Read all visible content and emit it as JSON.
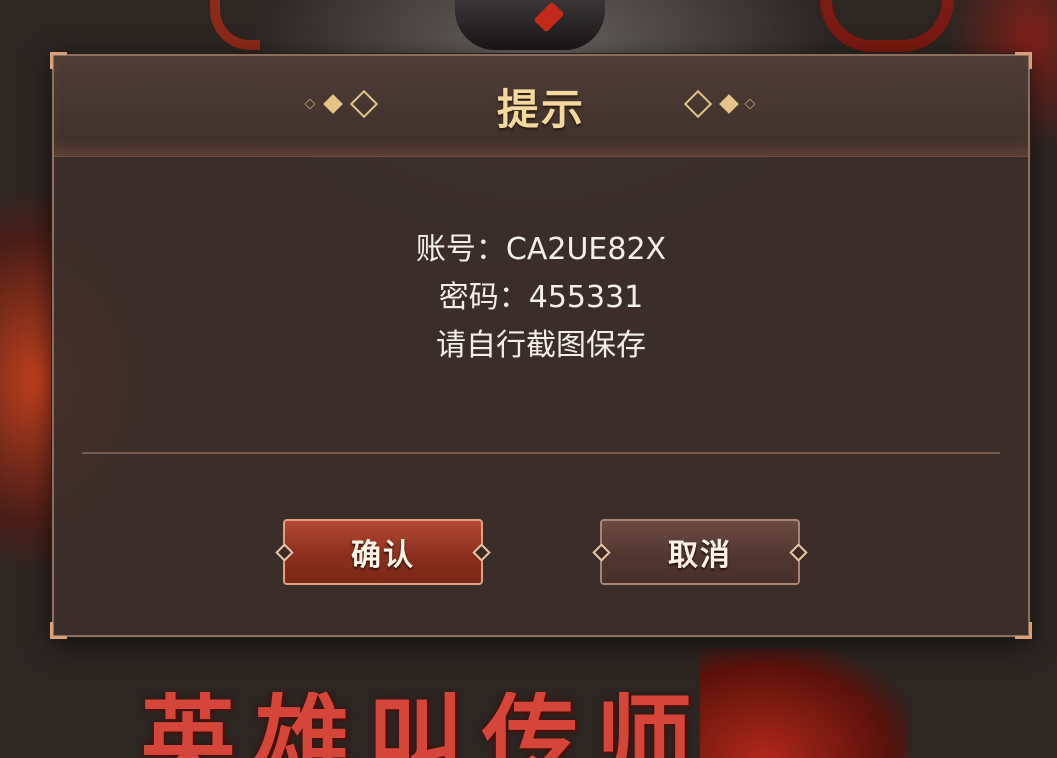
{
  "dialog": {
    "title": "提示",
    "account_line": "账号：CA2UE82X",
    "password_line": "密码：455331",
    "hint_line": "请自行截图保存",
    "confirm_label": "确认",
    "cancel_label": "取消"
  },
  "background": {
    "logo_text": "英雄叫传师"
  },
  "colors": {
    "title_gold": "#f3d9a0",
    "confirm_red": "#8c2f1e",
    "cancel_brown": "#523731",
    "panel": "#3c2f2b"
  },
  "icons": {
    "ornament": "diamond-ornament-icon"
  }
}
